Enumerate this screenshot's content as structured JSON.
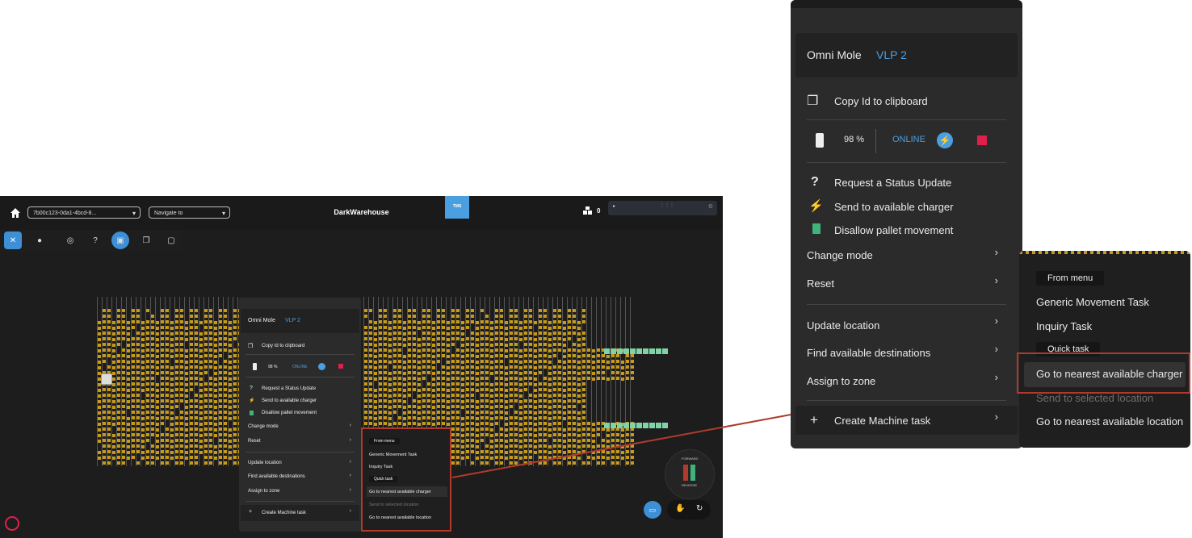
{
  "header": {
    "robot_select": "7b00c123-0da1-4bcd-8...",
    "navigate_placeholder": "Navigate to",
    "site_name": "DarkWarehouse",
    "tms_label": "TMS",
    "counter": "0"
  },
  "control": {
    "forward": "FORWARD",
    "reverse": "REVERSE"
  },
  "menu": {
    "robot_type": "Omni Mole",
    "robot_name": "VLP 2",
    "copy_id": "Copy Id to clipboard",
    "battery": "98 %",
    "status": "ONLINE",
    "request_status": "Request a Status Update",
    "send_charger": "Send to available charger",
    "disallow_pallet": "Disallow pallet movement",
    "change_mode": "Change mode",
    "reset": "Reset",
    "update_location": "Update location",
    "find_destinations": "Find available destinations",
    "assign_zone": "Assign to zone",
    "create_task": "Create Machine task"
  },
  "submenu": {
    "from_menu": "From menu",
    "generic_task": "Generic Movement Task",
    "inquiry_task": "Inquiry Task",
    "quick_task": "Quick task",
    "nearest_charger": "Go to nearest available charger",
    "send_selected": "Send to selected location",
    "nearest_location": "Go to nearest available location"
  },
  "colors": {
    "accent": "#4a9fe0",
    "rack": "#c79a1a",
    "highlight_frame": "#b03a2e",
    "stop": "#e0204a",
    "pallet_green": "#3fb37a"
  }
}
